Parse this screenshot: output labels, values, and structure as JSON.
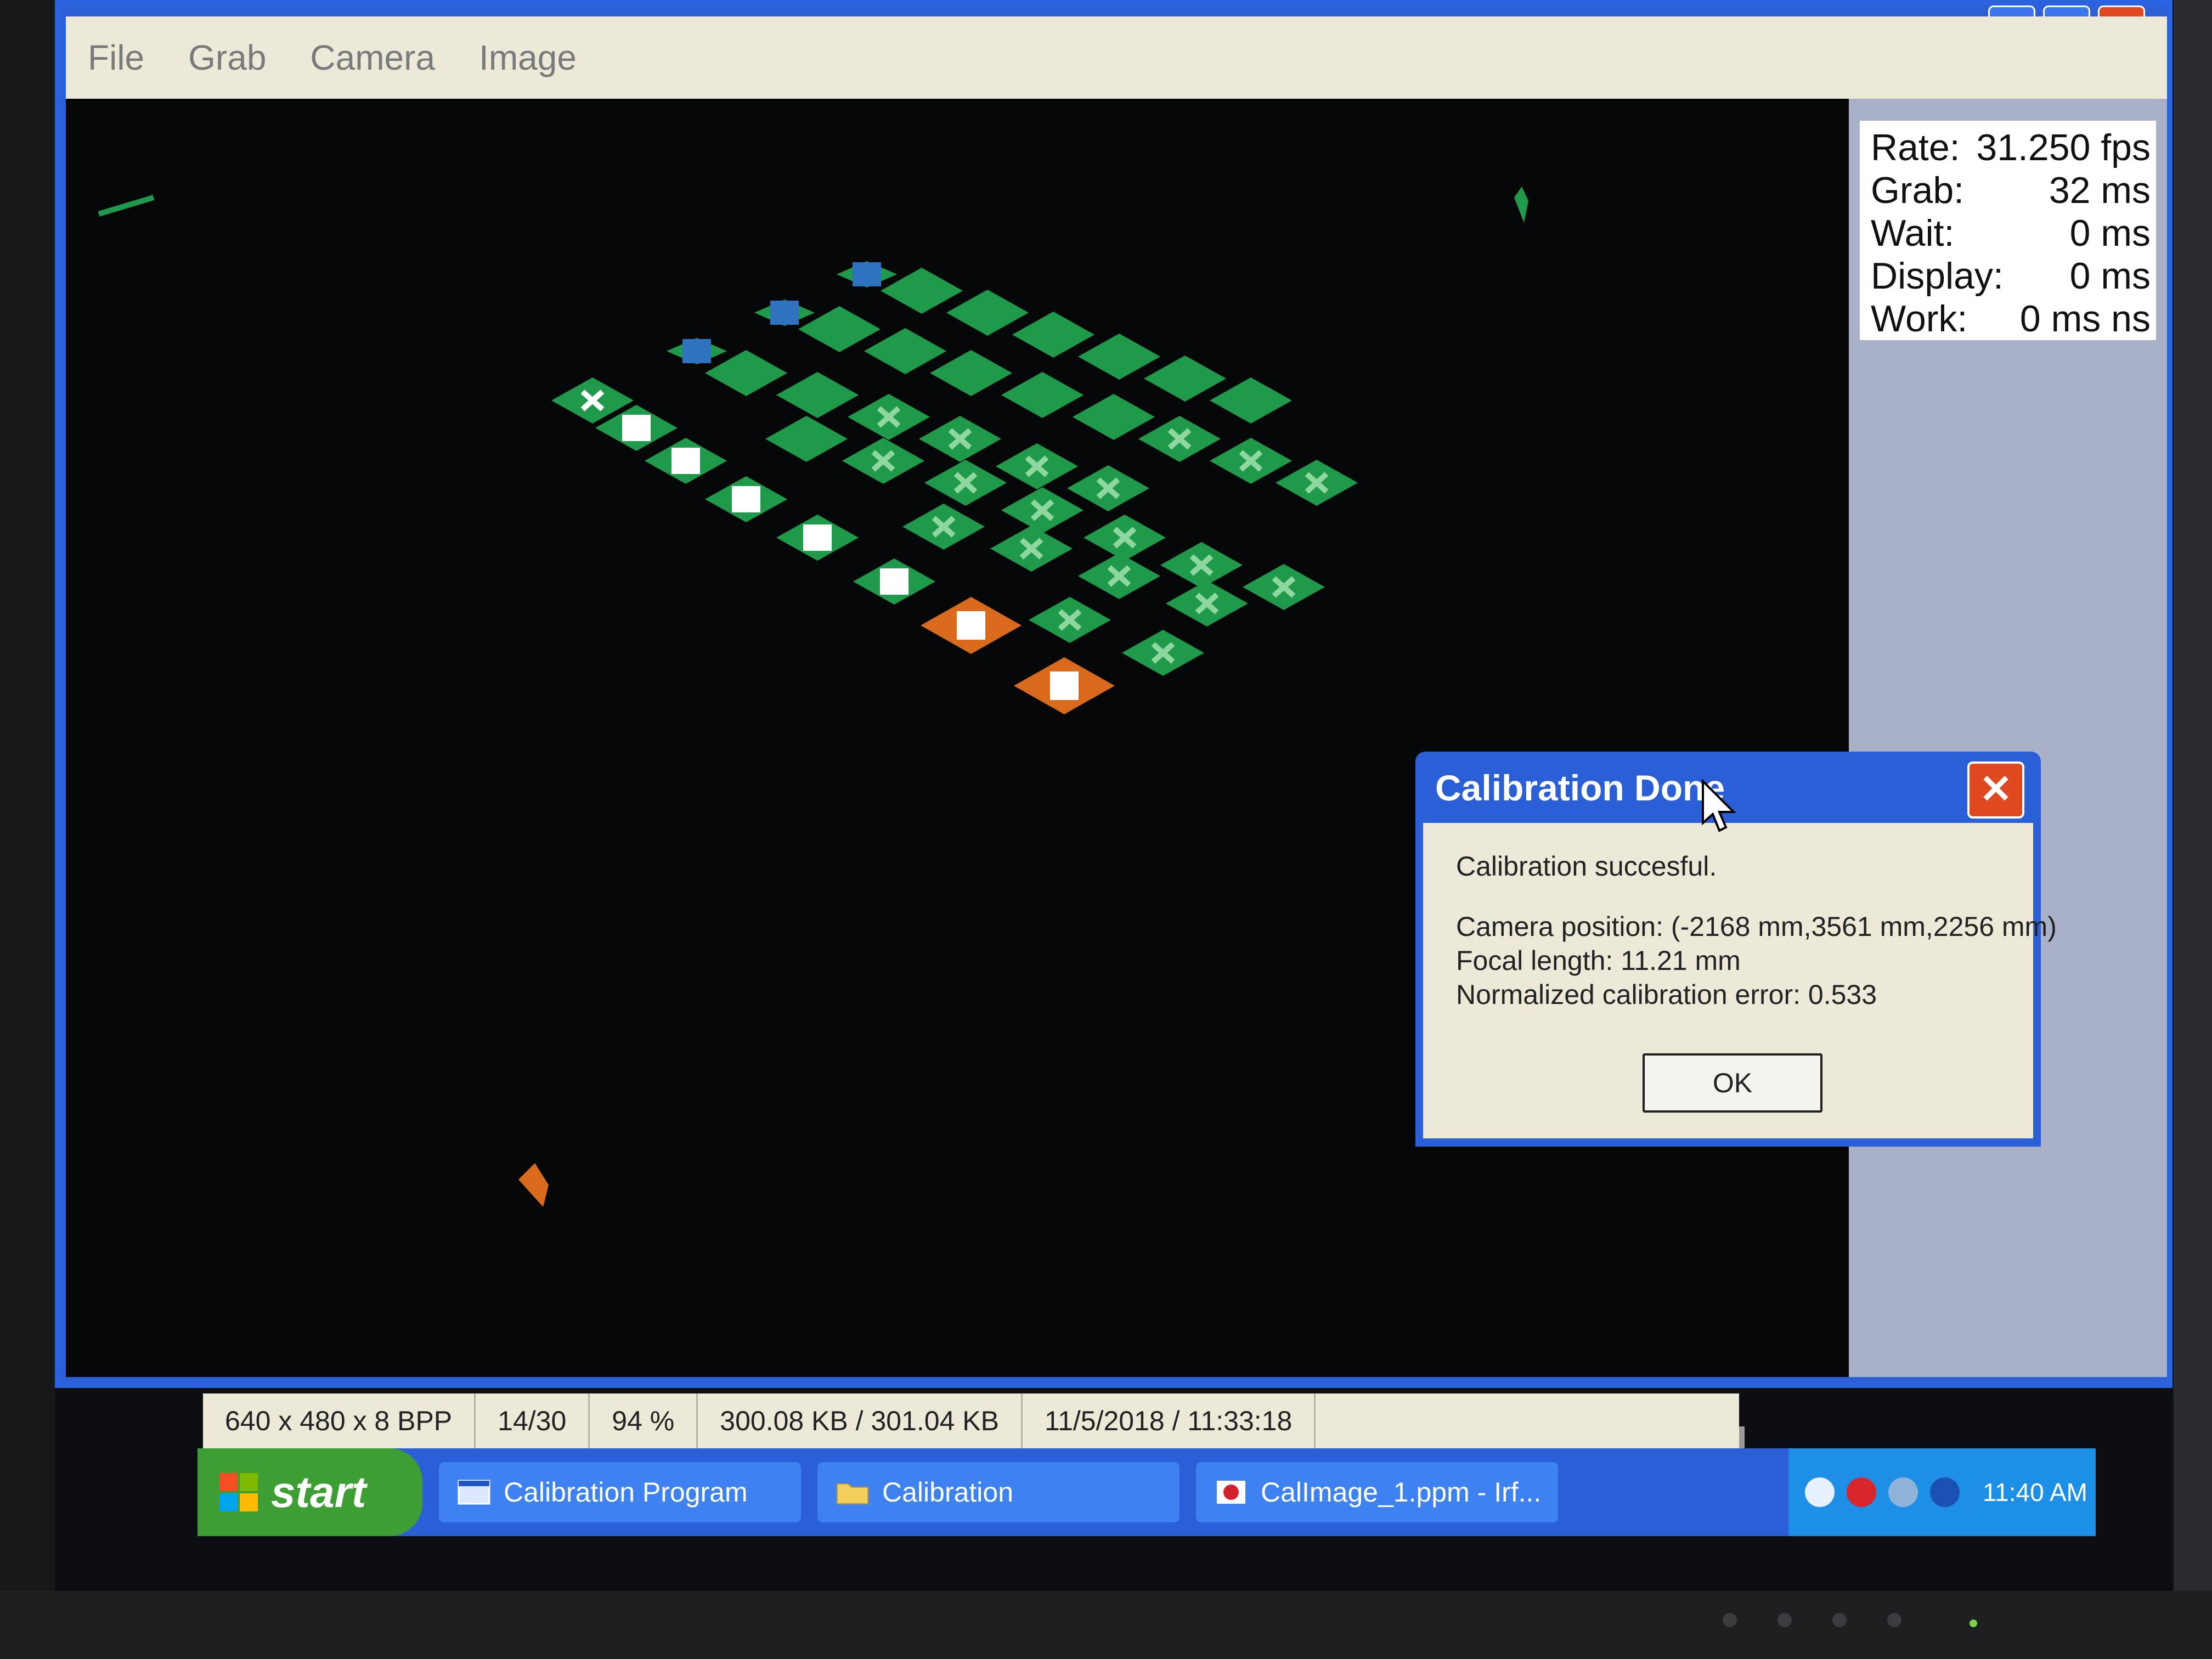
{
  "menu": {
    "items": [
      "File",
      "Grab",
      "Camera",
      "Image"
    ]
  },
  "window_controls": {
    "minimize": "▁",
    "maximize": "□",
    "close": "✕"
  },
  "stats": {
    "rate_label": "Rate:",
    "rate_value": "31.250 fps",
    "grab_label": "Grab:",
    "grab_value": "32 ms",
    "wait_label": "Wait:",
    "wait_value": "0 ms",
    "display_label": "Display:",
    "display_value": "0 ms",
    "work_label": "Work:",
    "work_value": "0 ms ns"
  },
  "statusbar": {
    "dimensions": "640 x 480 x 8 BPP",
    "frame": "14/30",
    "zoom": "94 %",
    "size": "300.08 KB / 301.04 KB",
    "datetime": "11/5/2018 / 11:33:18"
  },
  "taskbar": {
    "start_label": "start",
    "tasks": [
      "Calibration Program",
      "Calibration",
      "CalImage_1.ppm - Irf..."
    ],
    "clock": "11:40 AM"
  },
  "dialog": {
    "title": "Calibration Done",
    "close_glyph": "✕",
    "message": "Calibration succesful.",
    "camera_position": "Camera position: (-2168 mm,3561 mm,2256 mm)",
    "focal_length": "Focal length: 11.21 mm",
    "calibration_error": "Normalized calibration error: 0.533",
    "ok_label": "OK"
  },
  "colors": {
    "marker_green": "#1f9a4a",
    "marker_orange": "#d96a1c",
    "marker_blue": "#2f73c0",
    "xp_blue": "#2a5fd8",
    "start_green": "#3c9e33"
  }
}
